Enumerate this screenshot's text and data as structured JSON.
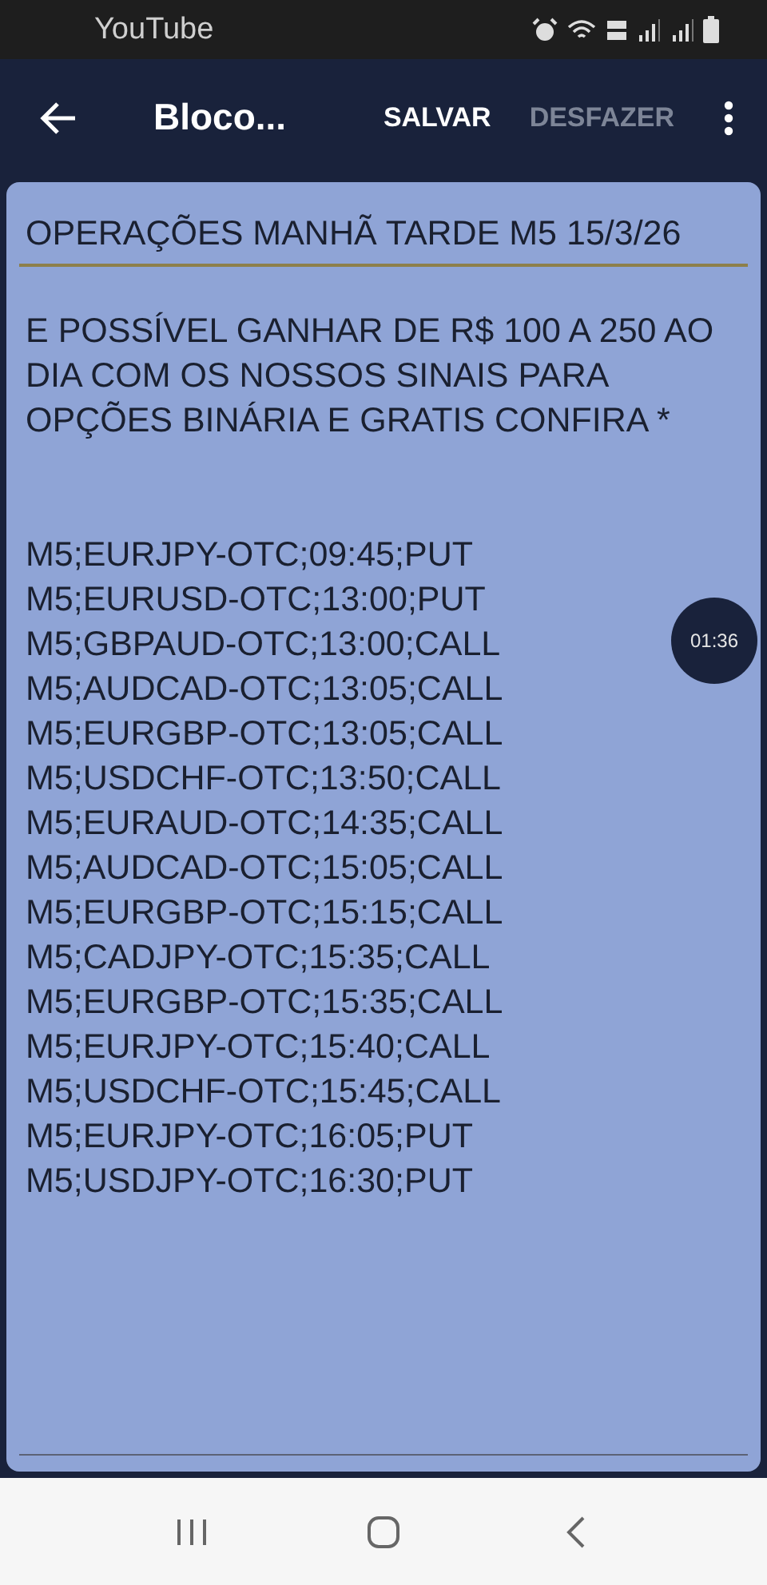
{
  "status_bar": {
    "app": "YouTube"
  },
  "app_bar": {
    "title": "Bloco...",
    "actions": [
      {
        "label": "SALVAR",
        "disabled": false
      },
      {
        "label": "DESFAZER",
        "disabled": true
      }
    ]
  },
  "note": {
    "title": "OPERAÇÕES MANHÃ TARDE M5 15/3/26",
    "paragraph": "E POSSÍVEL GANHAR DE R$ 100 A 250 AO DIA COM OS NOSSOS SINAIS PARA OPÇÕES BINÁRIA E GRATIS CONFIRA *",
    "lines": [
      "M5;EURJPY-OTC;09:45;PUT",
      "M5;EURUSD-OTC;13:00;PUT",
      "M5;GBPAUD-OTC;13:00;CALL",
      "M5;AUDCAD-OTC;13:05;CALL",
      "M5;EURGBP-OTC;13:05;CALL",
      "M5;USDCHF-OTC;13:50;CALL",
      "M5;EURAUD-OTC;14:35;CALL",
      "M5;AUDCAD-OTC;15:05;CALL",
      "M5;EURGBP-OTC;15:15;CALL",
      "M5;CADJPY-OTC;15:35;CALL",
      "M5;EURGBP-OTC;15:35;CALL",
      "M5;EURJPY-OTC;15:40;CALL",
      "M5;USDCHF-OTC;15:45;CALL",
      "M5;EURJPY-OTC;16:05;PUT",
      "M5;USDJPY-OTC;16:30;PUT"
    ]
  },
  "timer": "01:36"
}
